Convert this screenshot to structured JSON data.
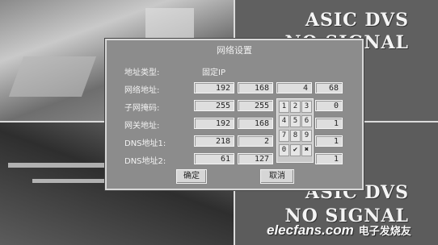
{
  "colors": {
    "dialog_bg": "#8c8c8c",
    "field_bg": "#dedede",
    "overlay_text": "#f4f4f4"
  },
  "overlay": {
    "top_right": [
      "ASIC DVS",
      "NO SIGNAL"
    ],
    "bottom_right": [
      "ASIC DVS",
      "NO SIGNAL"
    ]
  },
  "dialog": {
    "title": "网络设置",
    "address_type": {
      "label": "地址类型:",
      "value": "固定IP"
    },
    "rows": [
      {
        "label": "网络地址:",
        "octets": [
          "192",
          "168",
          "4",
          "68"
        ]
      },
      {
        "label": "子网掩码:",
        "octets": [
          "255",
          "255",
          "255",
          "0"
        ]
      },
      {
        "label": "网关地址:",
        "octets": [
          "192",
          "168",
          "",
          "1"
        ]
      },
      {
        "label": "DNS地址1:",
        "octets": [
          "218",
          "2",
          "",
          "1"
        ]
      },
      {
        "label": "DNS地址2:",
        "octets": [
          "61",
          "127",
          "",
          "1"
        ]
      }
    ],
    "keypad": [
      "1",
      "2",
      "3",
      "4",
      "5",
      "6",
      "7",
      "8",
      "9",
      "0",
      "✔",
      "✖"
    ],
    "ok_label": "确定",
    "cancel_label": "取消"
  },
  "watermark": {
    "brand": "elecfans.com",
    "suffix": "电子发烧友"
  }
}
